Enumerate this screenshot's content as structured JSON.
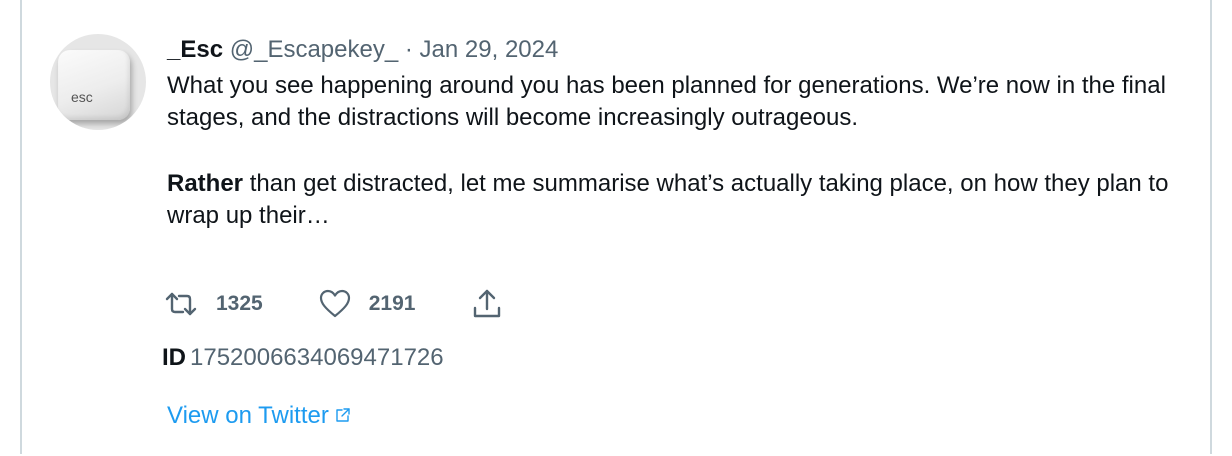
{
  "tweet": {
    "author_name": "_Esc",
    "handle": "@_Escapekey_",
    "separator": "·",
    "date": "Jan 29, 2024",
    "avatar_key_label": "esc",
    "paragraph1": "What you see happening around you has been planned for generations. We’re now in the final stages, and the distractions will become increasingly outrageous.",
    "paragraph2_bold": "Rather",
    "paragraph2_rest": " than get distracted, let me summarise what’s actually taking place, on how they plan to wrap up their…",
    "retweet_count": "1325",
    "like_count": "2191",
    "id_label": "ID",
    "id_value": "1752006634069471726",
    "view_link": "View on Twitter"
  },
  "icons": {
    "retweet": "retweet-icon",
    "like": "heart-icon",
    "share": "share-icon",
    "external": "external-link-icon"
  },
  "colors": {
    "link": "#1d9bf0",
    "muted": "#536471",
    "border": "#cfd9de"
  }
}
